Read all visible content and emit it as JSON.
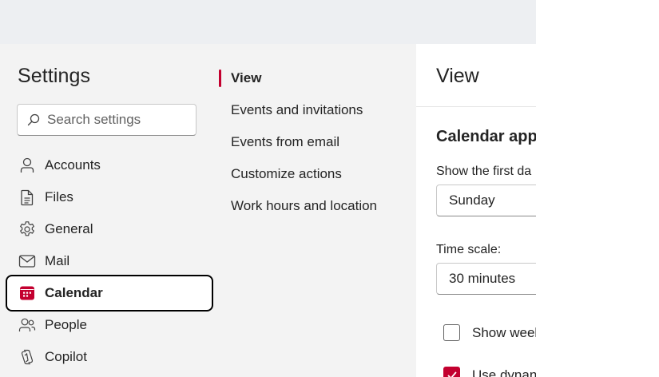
{
  "settings": {
    "title": "Settings",
    "search_placeholder": "Search settings"
  },
  "nav": {
    "items": [
      {
        "label": "Accounts",
        "icon": "person-icon"
      },
      {
        "label": "Files",
        "icon": "document-icon"
      },
      {
        "label": "General",
        "icon": "gear-icon"
      },
      {
        "label": "Mail",
        "icon": "mail-icon"
      },
      {
        "label": "Calendar",
        "icon": "calendar-icon",
        "active": true
      },
      {
        "label": "People",
        "icon": "people-icon"
      },
      {
        "label": "Copilot",
        "icon": "copilot-icon"
      }
    ]
  },
  "subnav": {
    "items": [
      {
        "label": "View",
        "active": true
      },
      {
        "label": "Events and invitations"
      },
      {
        "label": "Events from email"
      },
      {
        "label": "Customize actions"
      },
      {
        "label": "Work hours and location"
      }
    ]
  },
  "pane": {
    "title": "View",
    "section_title": "Calendar app",
    "first_day_label": "Show the first da",
    "first_day_value": "Sunday",
    "time_scale_label": "Time scale:",
    "time_scale_value": "30 minutes",
    "week_numbers_label": "Show weel",
    "week_numbers_checked": false,
    "dynamic_label": "Use dynan",
    "dynamic_checked": true
  },
  "colors": {
    "accent": "#c3002f",
    "panel_bg": "#f3f3f3",
    "topbar_bg": "#edeff2"
  }
}
